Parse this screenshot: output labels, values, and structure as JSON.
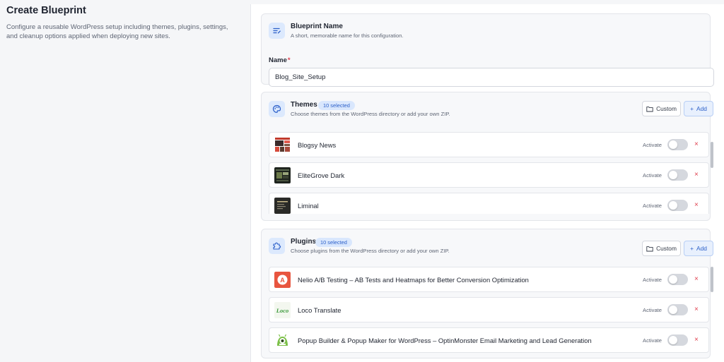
{
  "page": {
    "title": "Create Blueprint",
    "description": "Configure a reusable WordPress setup including themes, plugins, settings, and cleanup options applied when deploying new sites."
  },
  "blueprint": {
    "section_title": "Blueprint Name",
    "section_subtitle": "A short, memorable name for this configuration.",
    "field_label": "Name",
    "required_marker": "*",
    "name_value": "Blog_Site_Setup"
  },
  "themes": {
    "title": "Themes",
    "badge": "10 selected",
    "subtitle": "Choose themes from the WordPress directory or add your own ZIP.",
    "custom_label": "Custom",
    "add_label": "Add",
    "activate_label": "Activate",
    "items": [
      {
        "name": "Blogsy News",
        "icon": "blogsy-news-thumbnail",
        "active": false
      },
      {
        "name": "EliteGrove Dark",
        "icon": "elitegrove-dark-thumbnail",
        "active": false
      },
      {
        "name": "Liminal",
        "icon": "liminal-thumbnail",
        "active": false
      }
    ]
  },
  "plugins": {
    "title": "Plugins",
    "badge": "10 selected",
    "subtitle": "Choose plugins from the WordPress directory or add your own ZIP.",
    "custom_label": "Custom",
    "add_label": "Add",
    "activate_label": "Activate",
    "items": [
      {
        "name": "Nelio A/B Testing – AB Tests and Heatmaps for Better Conversion Optimization",
        "icon": "nelio-logo",
        "active": false
      },
      {
        "name": "Loco Translate",
        "icon": "loco-logo",
        "active": false
      },
      {
        "name": "Popup Builder & Popup Maker for WordPress – OptinMonster Email Marketing and Lead Generation",
        "icon": "optinmonster-logo",
        "active": false
      }
    ]
  },
  "icons": {
    "remove": "×",
    "add": "+"
  },
  "colors": {
    "accent": "#2b5fc9",
    "badge_bg": "#d9e7fd",
    "danger": "#e0414f"
  }
}
